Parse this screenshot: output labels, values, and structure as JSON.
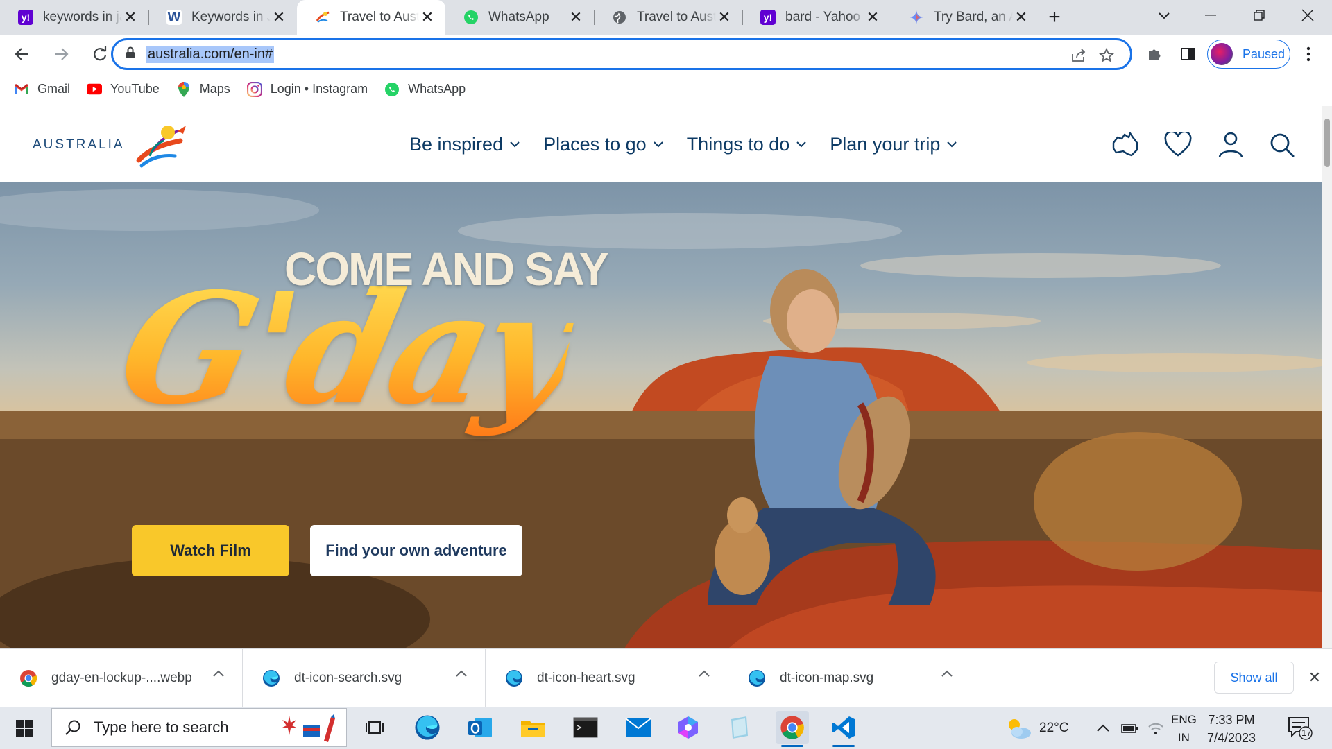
{
  "browser": {
    "tabs": [
      {
        "title": "keywords in java",
        "favicon_color": "#6001d2",
        "favicon": "y!"
      },
      {
        "title": "Keywords in Java",
        "favicon_color": "#2a5298",
        "favicon": "W"
      },
      {
        "title": "Travel to Australia",
        "favicon_color": "#ffffff",
        "favicon": "",
        "active": true
      },
      {
        "title": "WhatsApp",
        "favicon_color": "#25d366",
        "favicon": ""
      },
      {
        "title": "Travel to Australia",
        "favicon_color": "#5f6368",
        "favicon": ""
      },
      {
        "title": "bard - Yahoo Search",
        "favicon_color": "#6001d2",
        "favicon": "y!"
      },
      {
        "title": "Try Bard, an AI",
        "favicon_color": "#ffffff",
        "favicon": "✦"
      }
    ],
    "url": "australia.com/en-in#",
    "profile_label": "Paused",
    "bookmarks": [
      {
        "label": "Gmail",
        "icon": "gmail-icon"
      },
      {
        "label": "YouTube",
        "icon": "youtube-icon"
      },
      {
        "label": "Maps",
        "icon": "maps-icon"
      },
      {
        "label": "Login • Instagram",
        "icon": "instagram-icon"
      },
      {
        "label": "WhatsApp",
        "icon": "whatsapp-icon"
      }
    ]
  },
  "site": {
    "logo_text": "AUSTRALIA",
    "nav": [
      {
        "label": "Be inspired"
      },
      {
        "label": "Places to go"
      },
      {
        "label": "Things to do"
      },
      {
        "label": "Plan your trip"
      }
    ],
    "hero": {
      "headline_top": "COME AND SAY",
      "headline_main": "G'day",
      "primary_button": "Watch Film",
      "secondary_button": "Find your own adventure"
    }
  },
  "downloads": {
    "items": [
      {
        "name": "gday-en-lockup-....webp",
        "icon": "chrome-icon"
      },
      {
        "name": "dt-icon-search.svg",
        "icon": "edge-icon"
      },
      {
        "name": "dt-icon-heart.svg",
        "icon": "edge-icon"
      },
      {
        "name": "dt-icon-map.svg",
        "icon": "edge-icon"
      }
    ],
    "show_all": "Show all"
  },
  "taskbar": {
    "search_placeholder": "Type here to search",
    "weather": "22°C",
    "lang_top": "ENG",
    "lang_bottom": "IN",
    "time": "7:33 PM",
    "date": "7/4/2023",
    "notifications": "17"
  }
}
